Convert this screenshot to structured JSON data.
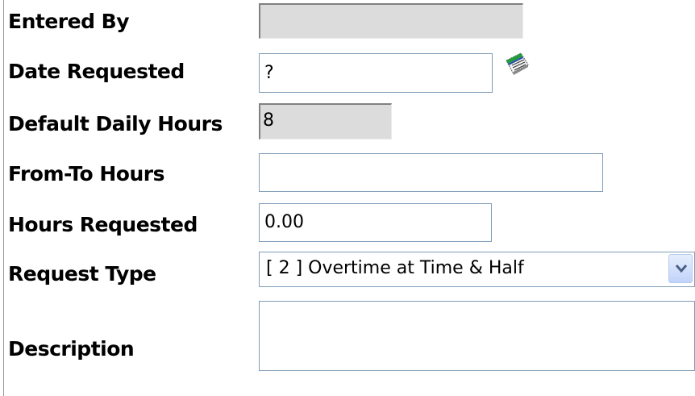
{
  "form": {
    "entered_by": {
      "label": "Entered By",
      "value": ""
    },
    "date_requested": {
      "label": "Date Requested",
      "value": "?"
    },
    "default_daily_hours": {
      "label": "Default Daily Hours",
      "value": "8"
    },
    "from_to_hours": {
      "label": "From-To Hours",
      "value": ""
    },
    "hours_requested": {
      "label": "Hours Requested",
      "value": "0.00"
    },
    "request_type": {
      "label": "Request Type",
      "selected": "[ 2 ] Overtime at Time & Half"
    },
    "description": {
      "label": "Description",
      "value": ""
    }
  },
  "icons": {
    "date_picker": "calendar-icon",
    "dropdown": "chevron-down-icon"
  },
  "colors": {
    "field_border": "#7f9db9",
    "disabled_bg": "#dcdcdc",
    "dropdown_chevron": "#4d6185"
  }
}
